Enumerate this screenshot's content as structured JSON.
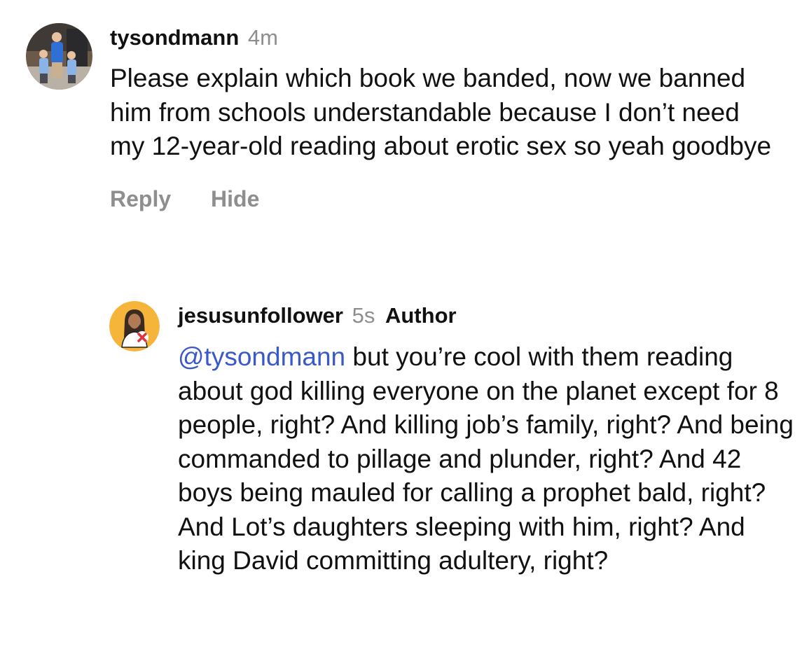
{
  "comments": [
    {
      "username": "tysondmann",
      "time": "4m",
      "text": "Please explain which book we banded, now we banned him from schools understandable because I don’t need my 12-year-old reading about erotic sex so yeah goodbye",
      "actions": {
        "reply": "Reply",
        "hide": "Hide"
      },
      "avatar_icon": "profile-photo-adult-and-two-children"
    },
    {
      "username": "jesusunfollower",
      "time": "5s",
      "badge": "Author",
      "mention": "@tysondmann",
      "text": " but you’re cool with them reading about god killing everyone on the planet except for 8 people, right? And killing job’s family, right? And being commanded to pillage and plunder, right? And 42 boys being mauled for calling a prophet bald, right? And Lot’s daughters sleeping with him, right? And king David committing adultery, right?",
      "avatar_icon": "jesus-figure-with-red-x-icon"
    }
  ],
  "colors": {
    "mention": "#3a59c9",
    "muted": "#8e8e8e",
    "avatar2_bg": "#f5b53b",
    "avatar2_x": "#e0343a"
  }
}
